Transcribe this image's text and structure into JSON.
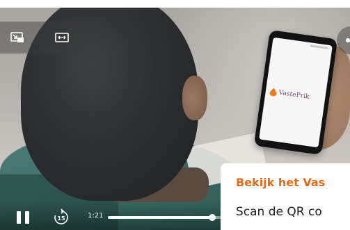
{
  "video": {
    "brand_on_phone": "VastePrik",
    "current_time": "1:21",
    "progress_fraction": 0.88,
    "skip_seconds": "15",
    "controls": {
      "pip_icon": "picture-in-picture-icon",
      "fit_icon": "fit-width-icon",
      "pause_icon": "pause-icon",
      "skip_icon": "skip-forward-15-icon"
    }
  },
  "card": {
    "title": "Bekijk het Vas",
    "text": "Scan de QR co"
  },
  "colors": {
    "accent_orange": "#e36a17",
    "brand_purple": "#6b3f66",
    "drop_orange": "#ef7d1a"
  }
}
